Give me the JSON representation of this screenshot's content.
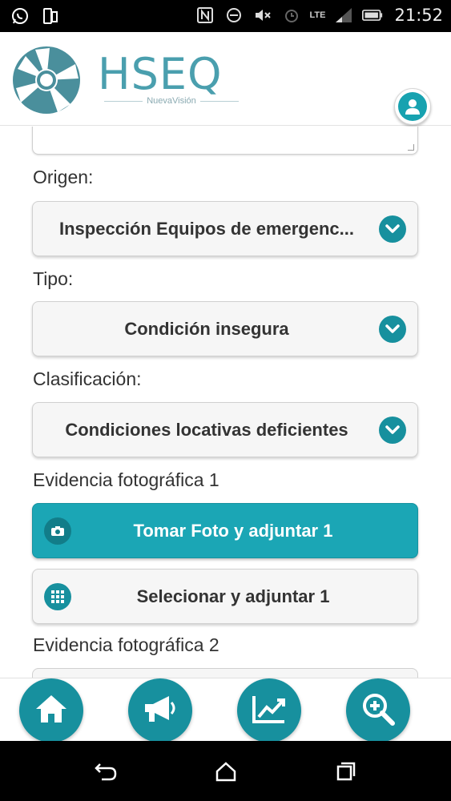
{
  "status_bar": {
    "time": "21:52",
    "network": "LTE",
    "icons": [
      "whatsapp-icon",
      "device-icon",
      "nfc-icon",
      "do-not-disturb-icon",
      "mute-icon",
      "alarm-icon",
      "signal-icon",
      "battery-icon"
    ]
  },
  "header": {
    "brand": "HSEQ",
    "tagline": "NuevaVisión",
    "icons": [
      "aperture-logo-icon",
      "user-icon"
    ]
  },
  "form": {
    "origen": {
      "label": "Origen:",
      "value": "Inspección Equipos de emergenc..."
    },
    "tipo": {
      "label": "Tipo:",
      "value": "Condición insegura"
    },
    "clasificacion": {
      "label": "Clasificación:",
      "value": "Condiciones locativas deficientes"
    },
    "evidencia1": {
      "label": "Evidencia fotográfica 1",
      "take_photo_label": "Tomar Foto y adjuntar 1",
      "select_label": "Selecionar y adjuntar 1"
    },
    "evidencia2": {
      "label": "Evidencia fotográfica 2"
    }
  },
  "colors": {
    "accent": "#1ba6b5",
    "accent_dark": "#17909e",
    "brand_text": "#4a9fae"
  },
  "bottom_nav": {
    "icons": [
      "home-icon",
      "megaphone-icon",
      "chart-trend-icon",
      "zoom-in-icon"
    ]
  },
  "system_nav": {
    "icons": [
      "back-icon",
      "home-outline-icon",
      "recents-icon"
    ]
  }
}
